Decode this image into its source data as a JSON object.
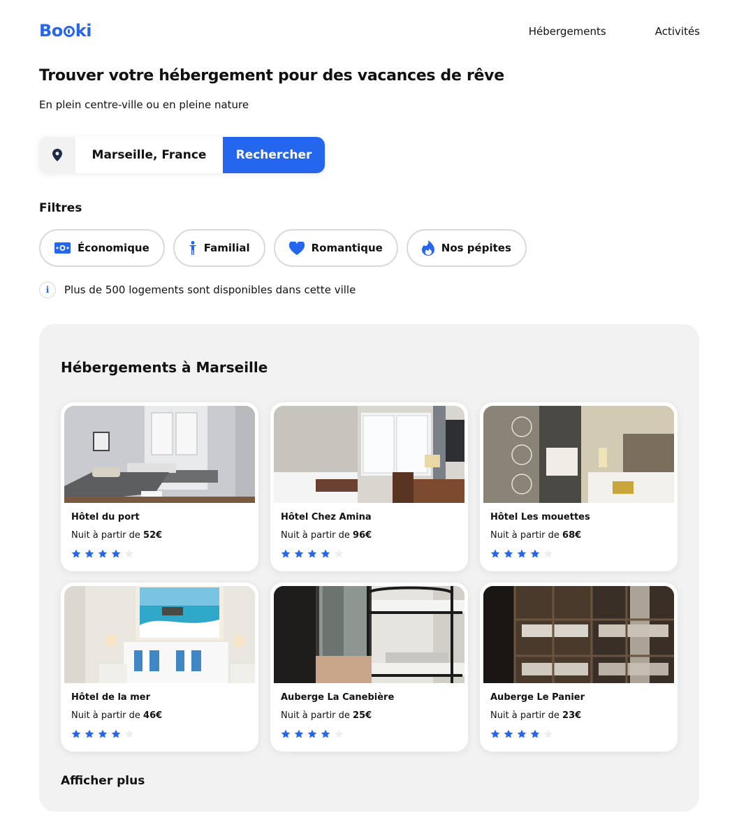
{
  "header": {
    "logo": "Booki",
    "logo_start": "Bo",
    "logo_end": "ki",
    "nav": [
      "Hébergements",
      "Activités"
    ]
  },
  "hero": {
    "title": "Trouver votre hébergement pour des vacances de rêve",
    "subtitle": "En plein centre-ville ou en pleine nature"
  },
  "search": {
    "location_icon": "location-pin-icon",
    "city": "Marseille, France",
    "button": "Rechercher"
  },
  "filters": {
    "title": "Filtres",
    "items": [
      {
        "label": "Économique",
        "icon": "money-icon"
      },
      {
        "label": "Familial",
        "icon": "person-icon"
      },
      {
        "label": "Romantique",
        "icon": "heart-icon"
      },
      {
        "label": "Nos pépites",
        "icon": "flame-icon"
      }
    ]
  },
  "info": {
    "icon": "info-icon",
    "text": "Plus de 500 logements sont disponibles dans cette ville"
  },
  "listings": {
    "title": "Hébergements à Marseille",
    "price_prefix": "Nuit à partir de ",
    "cards": [
      {
        "name": "Hôtel du port",
        "price": "52€",
        "rating": 4,
        "max_rating": 5
      },
      {
        "name": "Hôtel Chez Amina",
        "price": "96€",
        "rating": 4,
        "max_rating": 5
      },
      {
        "name": "Hôtel Les mouettes",
        "price": "68€",
        "rating": 4,
        "max_rating": 5
      },
      {
        "name": "Hôtel de la mer",
        "price": "46€",
        "rating": 4,
        "max_rating": 5
      },
      {
        "name": "Auberge La Canebière",
        "price": "25€",
        "rating": 4,
        "max_rating": 5
      },
      {
        "name": "Auberge Le Panier",
        "price": "23€",
        "rating": 4,
        "max_rating": 5
      }
    ],
    "more": "Afficher plus"
  },
  "colors": {
    "accent": "#2466ee",
    "panel": "#f2f2f2",
    "star_empty": "#eeeeee"
  }
}
